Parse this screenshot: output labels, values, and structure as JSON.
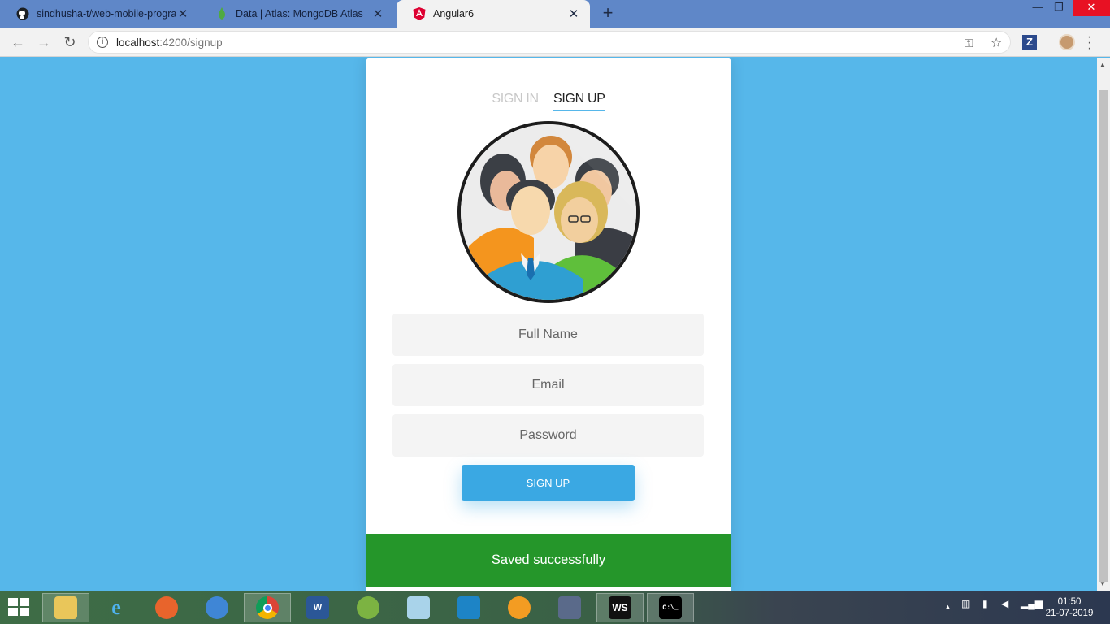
{
  "browser": {
    "tabs": [
      {
        "title": "sindhusha-t/web-mobile-progra",
        "icon": "github-icon",
        "active": false
      },
      {
        "title": "Data | Atlas: MongoDB Atlas",
        "icon": "mongodb-leaf-icon",
        "active": false
      },
      {
        "title": "Angular6",
        "icon": "angular-icon",
        "active": true
      }
    ],
    "new_tab": "+",
    "url_host": "localhost",
    "url_path": ":4200/signup",
    "extension_label": "Z"
  },
  "signup_card": {
    "tab_signin": "SIGN IN",
    "tab_signup": "SIGN UP",
    "avatar_icon": "user-group-icon",
    "fullname_placeholder": "Full Name",
    "email_placeholder": "Email",
    "password_placeholder": "Password",
    "submit_label": "SIGN UP"
  },
  "toast": {
    "message": "Saved successfully",
    "color": "#25962a"
  },
  "taskbar": {
    "apps": [
      "file-explorer-icon",
      "internet-explorer-icon",
      "firefox-icon",
      "app-icon",
      "chrome-icon",
      "word-icon",
      "android-studio-icon",
      "notepad-icon",
      "app-icon",
      "app-icon",
      "app-icon",
      "webstorm-icon",
      "cmd-icon"
    ],
    "webstorm_label": "WS",
    "word_label": "W",
    "cmd_label": "C:\\_",
    "time": "01:50",
    "date": "21-07-2019"
  },
  "colors": {
    "page_bg": "#56b7ea",
    "accent": "#3aa8e3"
  }
}
